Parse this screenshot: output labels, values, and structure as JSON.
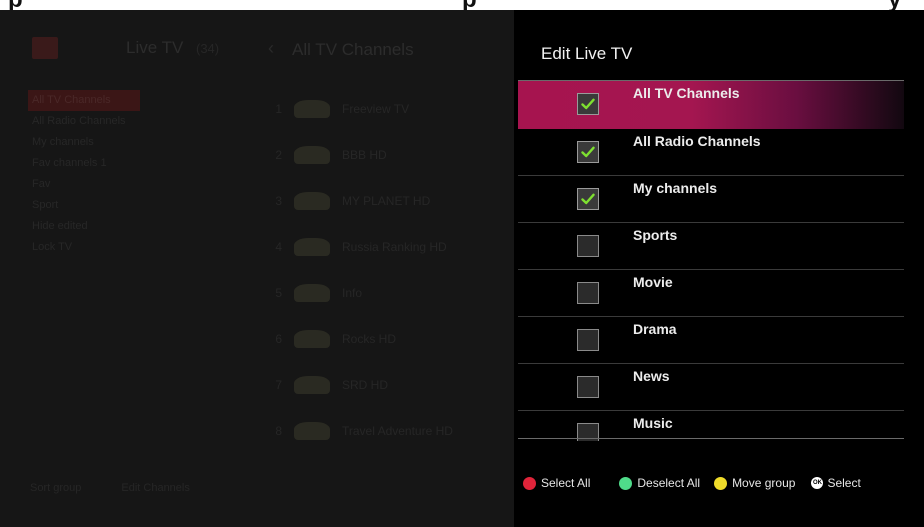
{
  "top_strip": {
    "left_text": "p",
    "mid_text": "p",
    "right_text": "y"
  },
  "background_app": {
    "app_title": "Live TV",
    "app_title_count": "(34)",
    "list_title": "All TV Channels",
    "groups": [
      "All TV Channels",
      "All Radio Channels",
      "My channels",
      "Fav channels 1",
      "Fav",
      "Sport",
      "Hide edited",
      "Lock TV"
    ],
    "channels": [
      {
        "num": "1",
        "name": "Freeview TV"
      },
      {
        "num": "2",
        "name": "BBB HD"
      },
      {
        "num": "3",
        "name": "MY PLANET HD"
      },
      {
        "num": "4",
        "name": "Russia Ranking HD"
      },
      {
        "num": "5",
        "name": "Info"
      },
      {
        "num": "6",
        "name": "Rocks HD"
      },
      {
        "num": "7",
        "name": "SRD HD"
      },
      {
        "num": "8",
        "name": "Travel Adventure HD"
      }
    ],
    "footer": [
      "Sort group",
      "Edit Channels"
    ]
  },
  "panel": {
    "title": "Edit Live TV",
    "items": [
      {
        "label": "All TV Channels",
        "checked": true,
        "focused": true
      },
      {
        "label": "All Radio Channels",
        "checked": true,
        "focused": false
      },
      {
        "label": "My channels",
        "checked": true,
        "focused": false
      },
      {
        "label": "Sports",
        "checked": false,
        "focused": false
      },
      {
        "label": "Movie",
        "checked": false,
        "focused": false
      },
      {
        "label": "Drama",
        "checked": false,
        "focused": false
      },
      {
        "label": "News",
        "checked": false,
        "focused": false
      },
      {
        "label": "Music",
        "checked": false,
        "focused": false
      }
    ]
  },
  "footer": {
    "select_all": {
      "label": "Select All",
      "color": "#e0243a"
    },
    "deselect_all": {
      "label": "Deselect All",
      "color": "#4fdc8a"
    },
    "move_group": {
      "label": "Move group",
      "color": "#f0dc2a"
    },
    "select": {
      "label": "Select",
      "icon_text": "OK"
    }
  },
  "colors": {
    "focus_gradient_start": "#a6144f",
    "check_green": "#7ee030",
    "panel_bg": "#000000"
  }
}
